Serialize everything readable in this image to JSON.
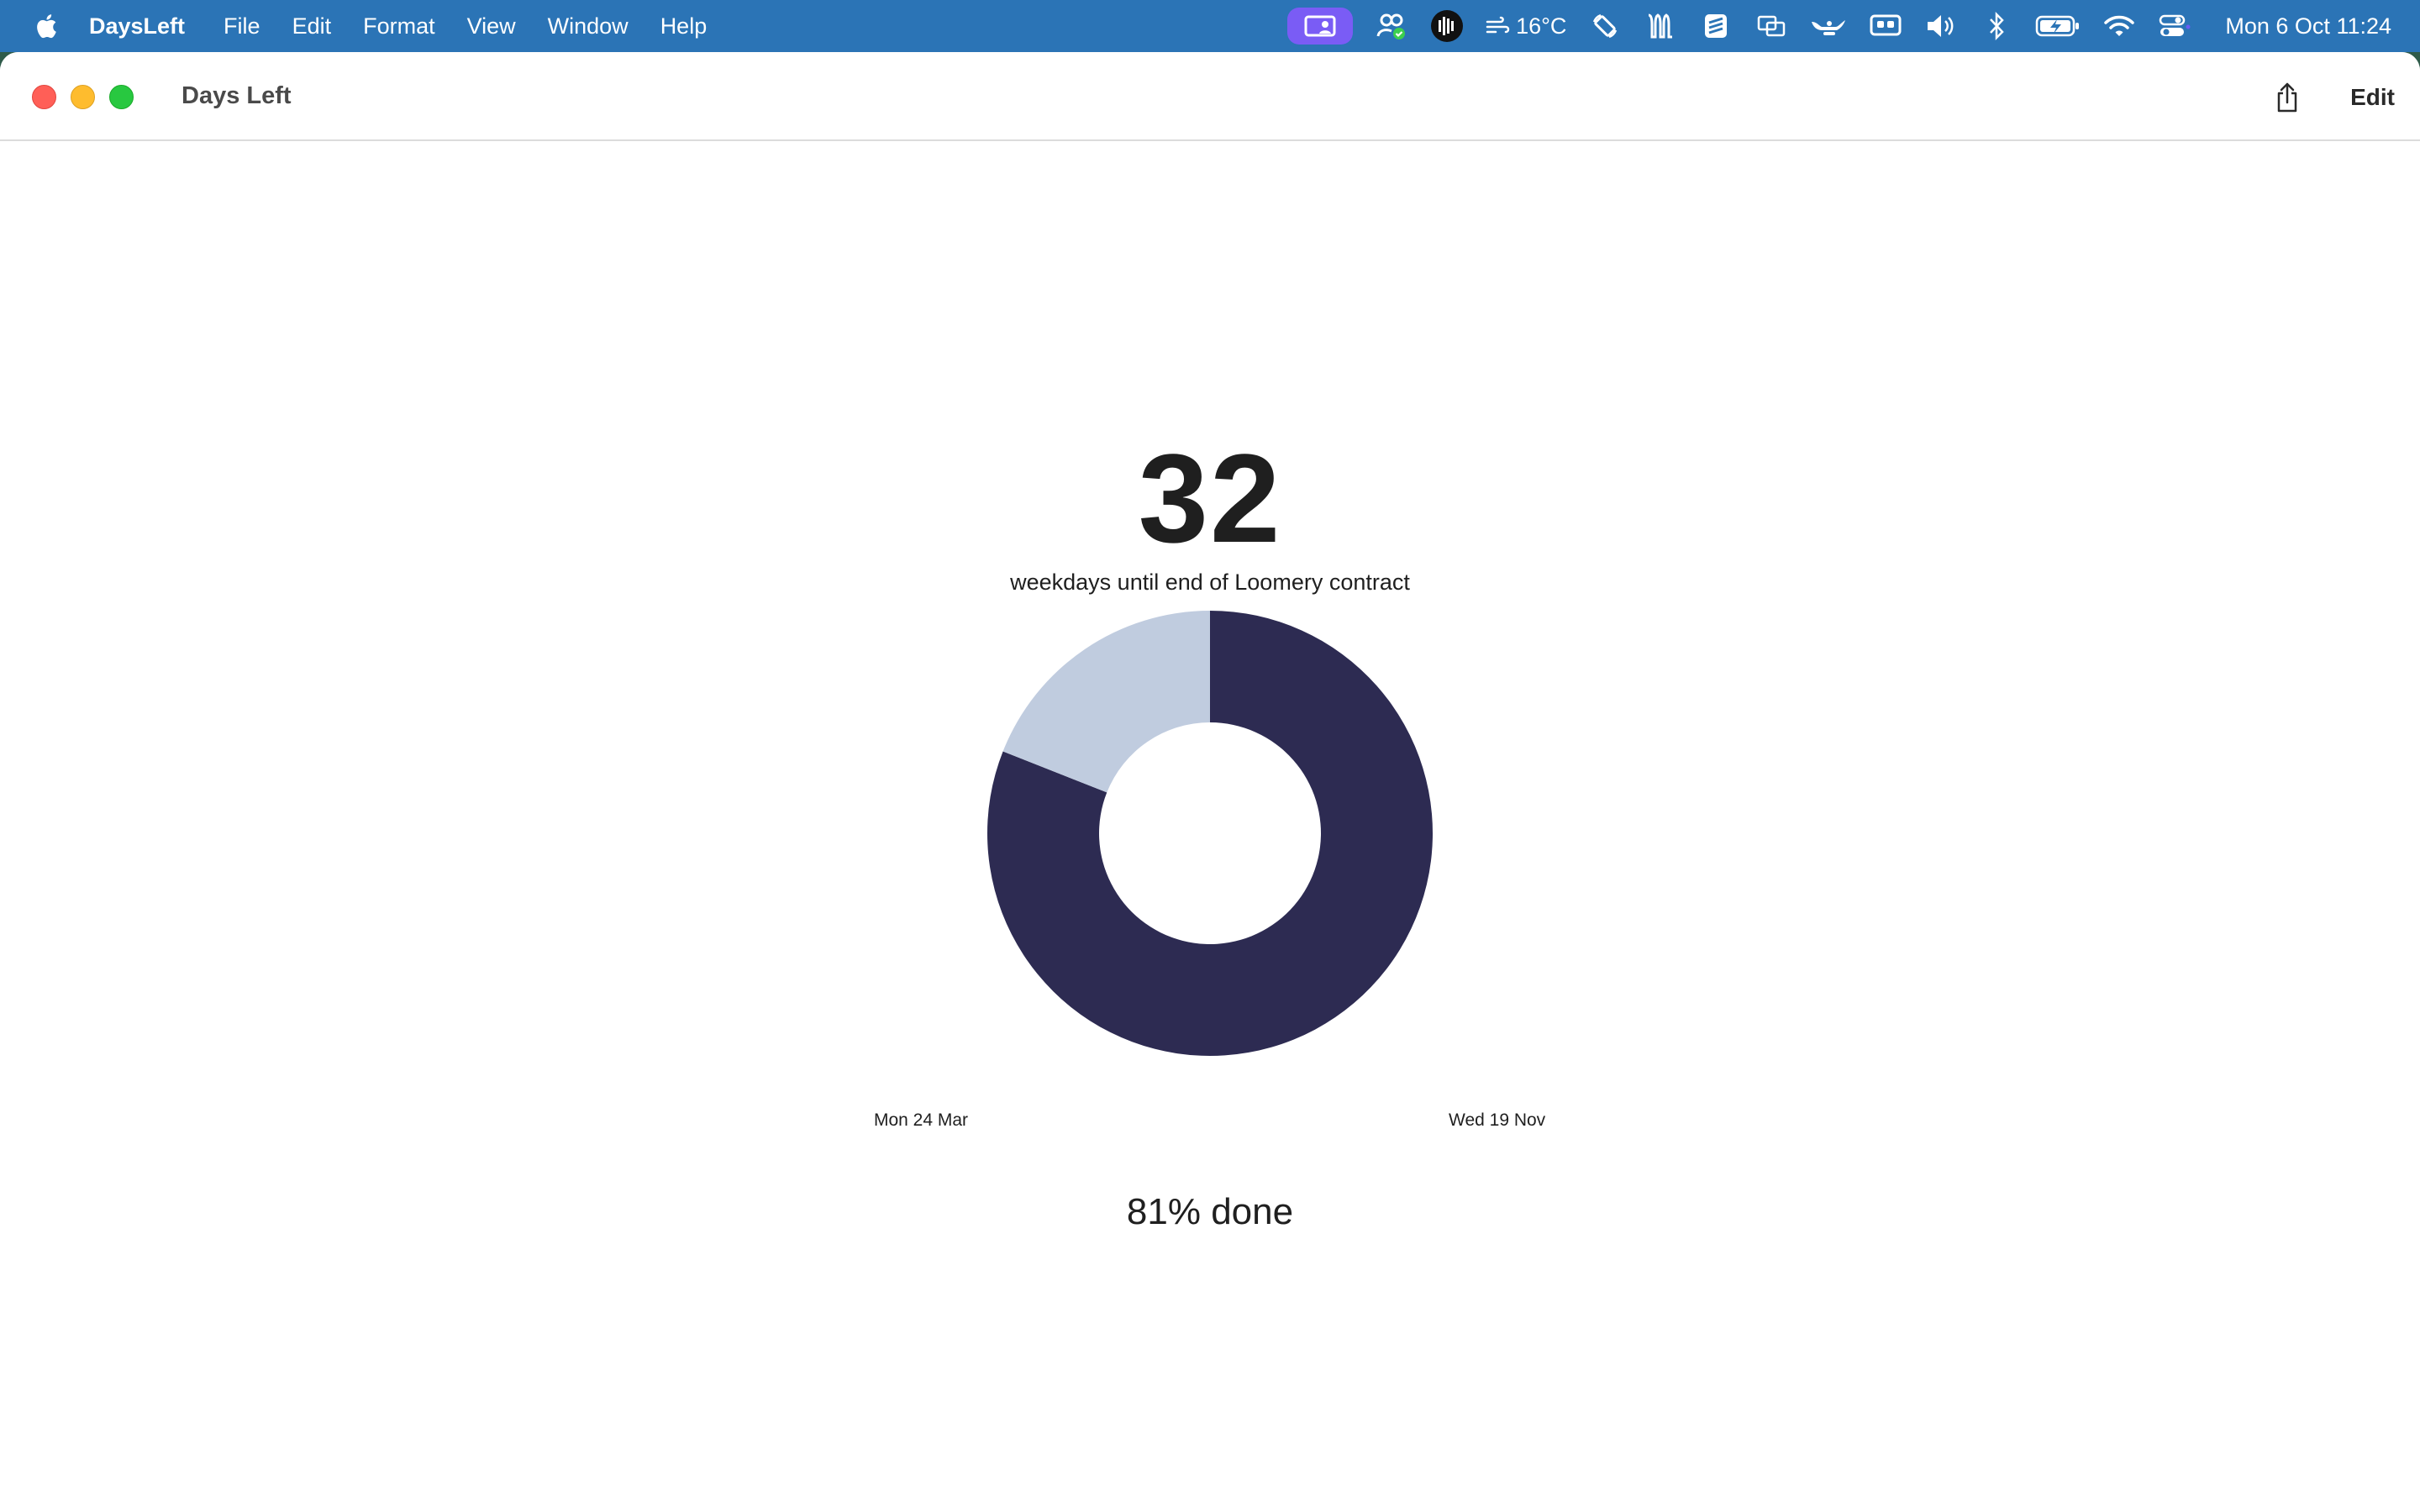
{
  "menubar": {
    "app_name": "DaysLeft",
    "menus": [
      "File",
      "Edit",
      "Format",
      "View",
      "Window",
      "Help"
    ],
    "weather": "16°C",
    "clock": "Mon 6 Oct  11:24",
    "accent_color": "#2b74b6",
    "screen_share_color": "#7a5cf5"
  },
  "window": {
    "title": "Days Left",
    "edit_label": "Edit"
  },
  "countdown": {
    "number": "32",
    "subtitle": "weekdays until end of Loomery contract",
    "start_date": "Mon 24 Mar",
    "end_date": "Wed 19 Nov",
    "progress_text": "81% done"
  },
  "chart_data": {
    "type": "pie",
    "donut": true,
    "slices": [
      {
        "label": "done",
        "fraction": 0.81,
        "color": "#2d2b52"
      },
      {
        "label": "remaining",
        "fraction": 0.19,
        "color": "#c0ccdf"
      }
    ],
    "start_angle": "top (12 o'clock)",
    "direction": "clockwise"
  }
}
